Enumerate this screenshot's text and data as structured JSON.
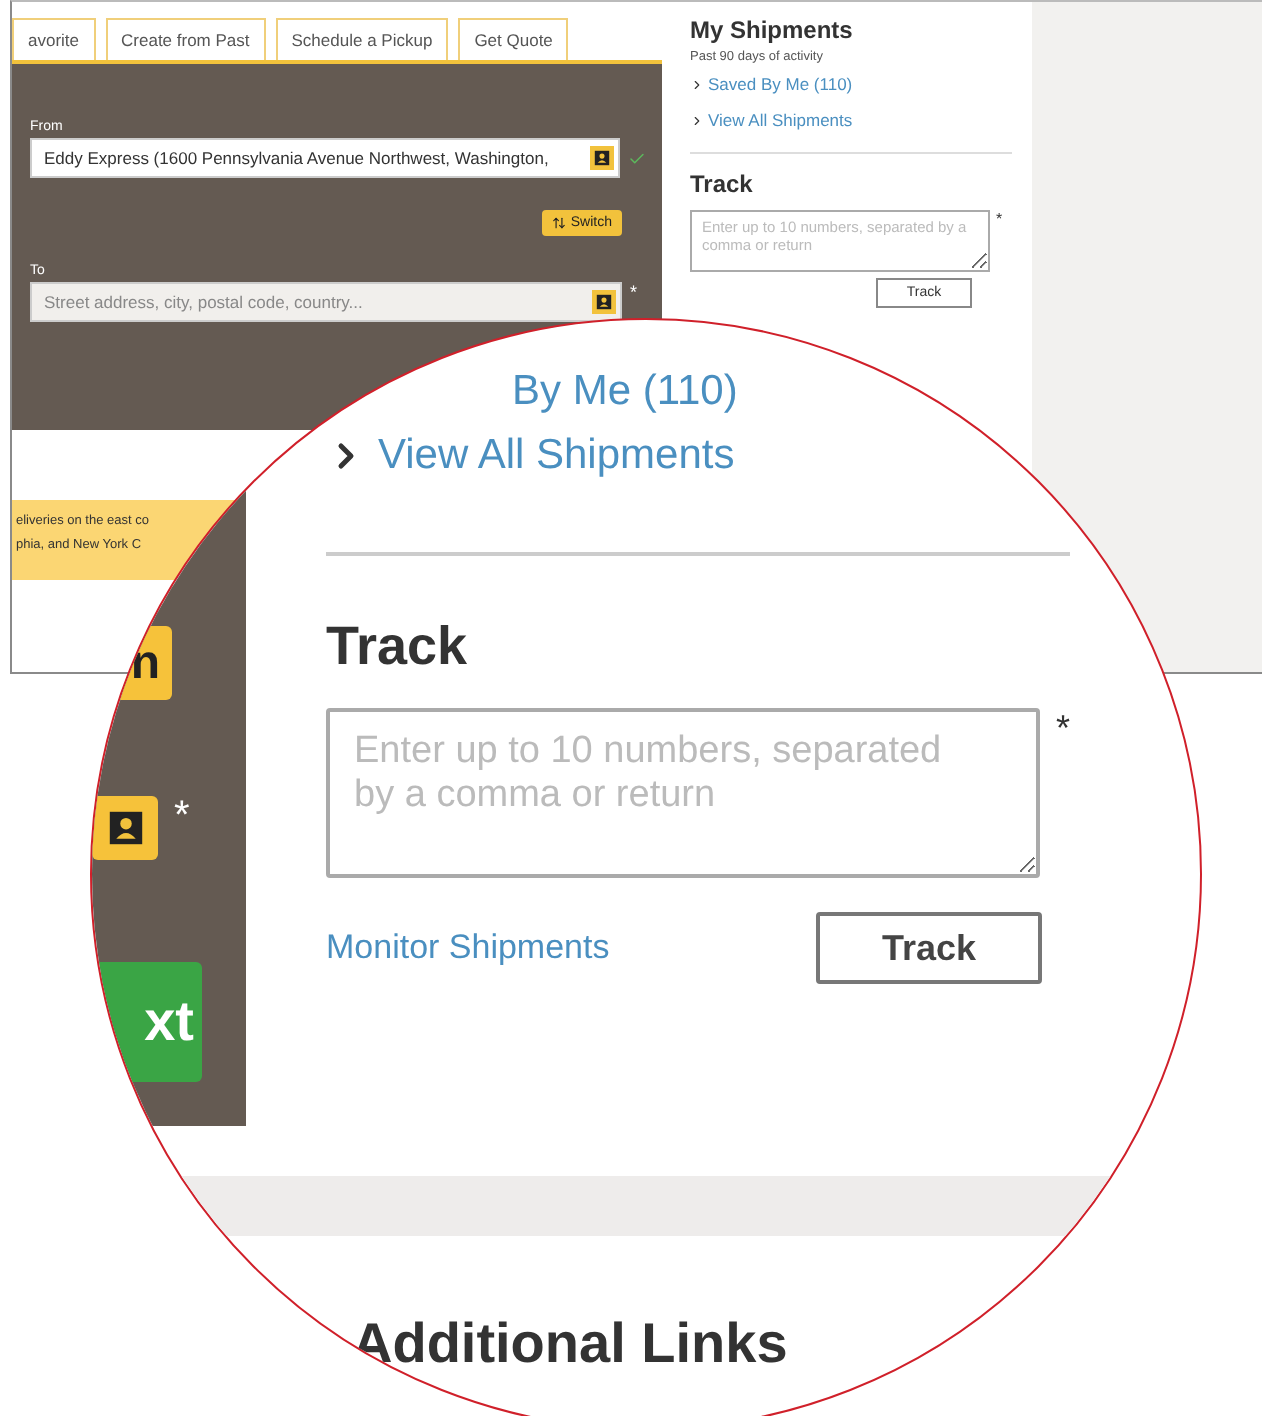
{
  "tabs": [
    {
      "label": "avorite",
      "selected": false
    },
    {
      "label": "Create from Past",
      "selected": false
    },
    {
      "label": "Schedule a Pickup",
      "selected": false
    },
    {
      "label": "Get Quote",
      "selected": false
    }
  ],
  "shipment_form": {
    "from": {
      "label": "From",
      "value": "Eddy Express (1600 Pennsylvania Avenue Northwest, Washington,",
      "valid": true
    },
    "switch_button": "Switch",
    "to": {
      "label": "To",
      "placeholder": "Street address, city, postal code, country...",
      "required_mark": "*"
    }
  },
  "notice": {
    "lines": [
      "eliveries on the east co",
      "phia, and New York C"
    ]
  },
  "sidebar": {
    "title": "My Shipments",
    "subtitle": "Past 90 days of activity",
    "links": [
      "Saved By Me (110)",
      "View All Shipments"
    ],
    "track": {
      "title": "Track",
      "placeholder": "Enter up to 10 numbers, separated by a comma or return",
      "required_mark": "*",
      "button": "Track"
    }
  },
  "magnifier": {
    "left_panel": {
      "button": "n",
      "required_mark": "*",
      "next_button": "xt"
    },
    "links": [
      "By Me (110)",
      "View All Shipments"
    ],
    "track": {
      "title": "Track",
      "placeholder": "Enter up to 10 numbers, separated by a comma or return",
      "required_mark": "*",
      "monitor_link": "Monitor Shipments",
      "button": "Track"
    },
    "section_title": "Additional Links"
  }
}
